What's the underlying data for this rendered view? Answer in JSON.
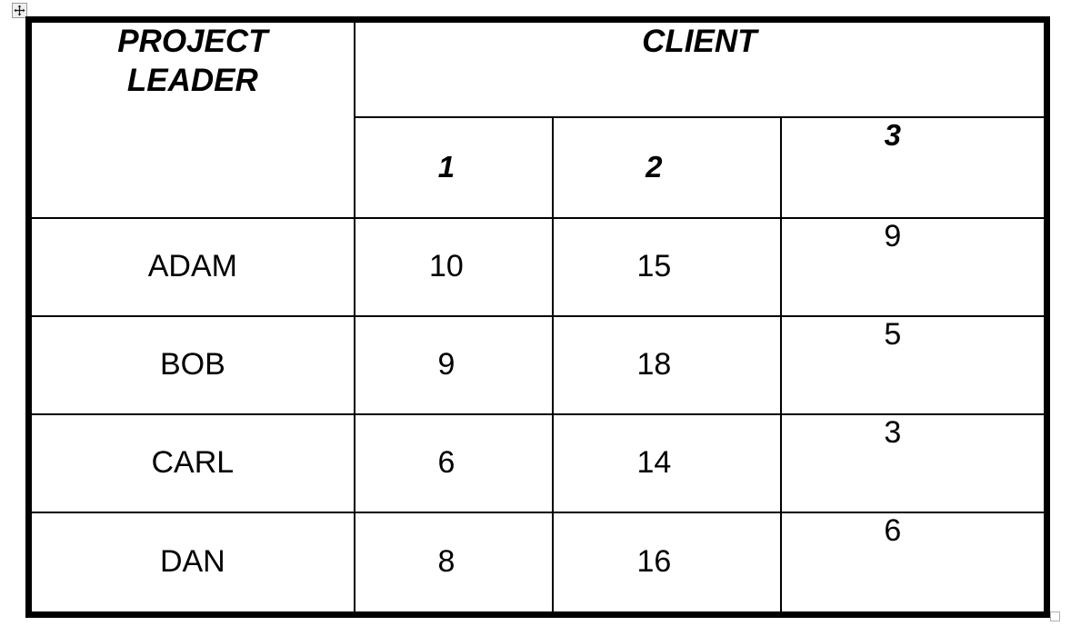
{
  "document": {
    "kind": "table",
    "background_color": "#ffffff",
    "border_color": "#000000"
  },
  "handles": {
    "move_handle_name": "table-move-handle",
    "resize_handle_name": "table-resize-handle"
  },
  "table": {
    "corner_header": "PROJECT\nLEADER",
    "corner_header_line1": "PROJECT",
    "corner_header_line2": "LEADER",
    "group_header": "CLIENT",
    "column_headers": [
      "1",
      "2",
      "3"
    ],
    "row_header_label": "PROJECT LEADER",
    "rows": [
      {
        "leader": "ADAM",
        "values": [
          "10",
          "15",
          "9"
        ]
      },
      {
        "leader": "BOB",
        "values": [
          "9",
          "18",
          "5"
        ]
      },
      {
        "leader": "CARL",
        "values": [
          "6",
          "14",
          "3"
        ]
      },
      {
        "leader": "DAN",
        "values": [
          "8",
          "16",
          "6"
        ]
      }
    ]
  },
  "chart_data": {
    "type": "table",
    "title": "",
    "categories": [
      "ADAM",
      "BOB",
      "CARL",
      "DAN"
    ],
    "series": [
      {
        "name": "1",
        "values": [
          10,
          9,
          6,
          8
        ]
      },
      {
        "name": "2",
        "values": [
          15,
          18,
          14,
          16
        ]
      },
      {
        "name": "3",
        "values": [
          9,
          5,
          3,
          6
        ]
      }
    ],
    "xlabel": "PROJECT LEADER",
    "ylabel": "CLIENT",
    "legend": [
      "1",
      "2",
      "3"
    ]
  }
}
